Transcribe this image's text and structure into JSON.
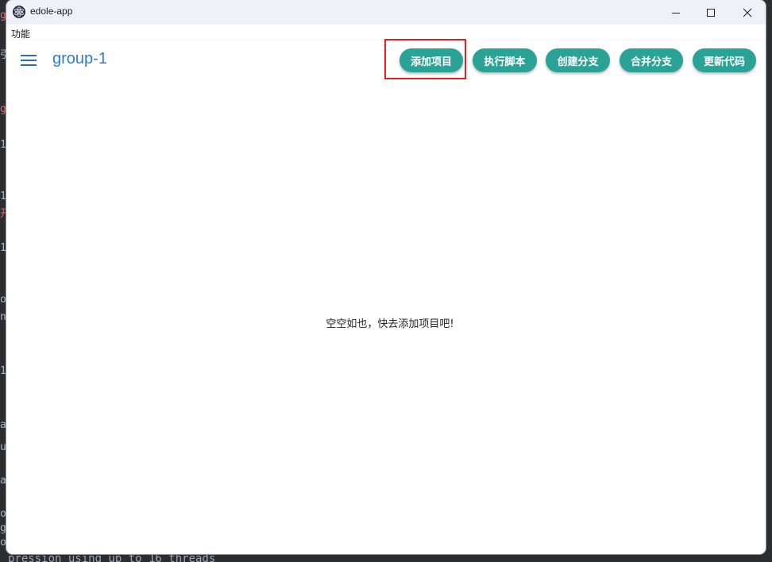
{
  "window": {
    "title": "edole-app"
  },
  "menu": {
    "items": [
      "功能"
    ]
  },
  "toolbar": {
    "title": "group-1",
    "buttons": [
      {
        "label": "添加项目"
      },
      {
        "label": "执行脚本"
      },
      {
        "label": "创建分支"
      },
      {
        "label": "合并分支"
      },
      {
        "label": "更新代码"
      }
    ]
  },
  "main": {
    "empty_message": "空空如也，快去添加项目吧!"
  },
  "background": {
    "terminal_line": "pression using up to 16 threads",
    "fragments": [
      "g",
      "引",
      "g",
      "1",
      "1",
      "开",
      "1",
      "o",
      "n",
      "1",
      "a",
      "u",
      "a",
      "o",
      "g",
      "o"
    ]
  },
  "colors": {
    "accent": "#2aa396",
    "title": "#2f7bd0",
    "highlight": "#e62020"
  }
}
